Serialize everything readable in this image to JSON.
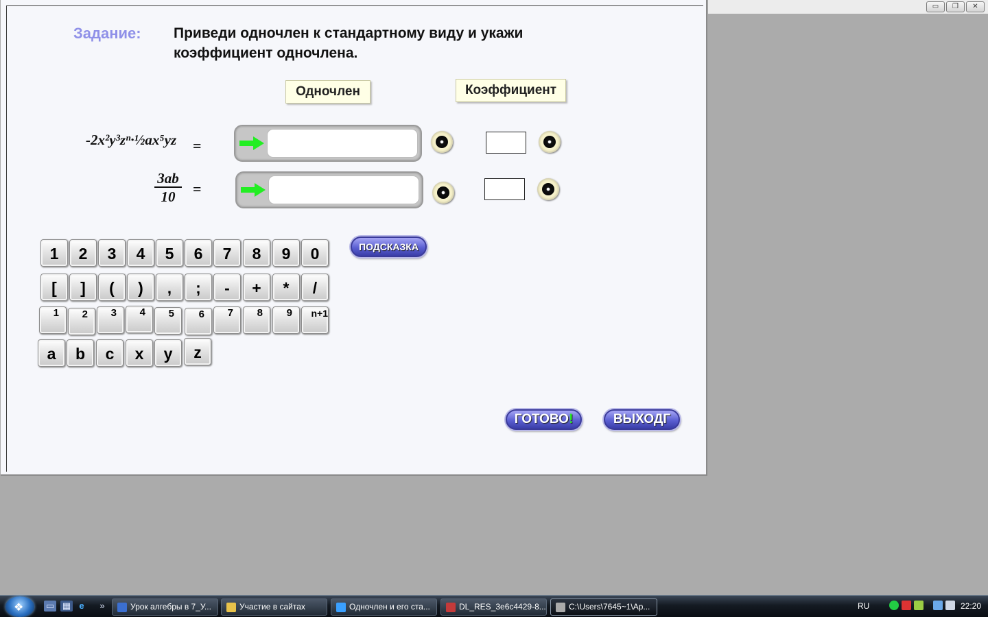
{
  "window": {
    "controls": [
      "minimize",
      "restore",
      "close"
    ],
    "control_glyphs": [
      "▭",
      "❐",
      "✕"
    ]
  },
  "task": {
    "label": "Задание:",
    "text": "Приведи одночлен к стандартному виду и укажи коэффициент одночлена."
  },
  "headers": {
    "monomial": "Одночлен",
    "coefficient": "Коэффициент"
  },
  "rows": [
    {
      "expression": "-2x²y³zⁿ·½ax⁵yz",
      "equals": "="
    },
    {
      "expression_numerator": "3ab",
      "expression_denominator": "10",
      "equals": "="
    }
  ],
  "keyboard": {
    "digits": [
      "1",
      "2",
      "3",
      "4",
      "5",
      "6",
      "7",
      "8",
      "9",
      "0"
    ],
    "symbols": [
      "[",
      "]",
      "(",
      ")",
      ",",
      ";",
      "-",
      "+",
      "*",
      "/"
    ],
    "powers": [
      "1",
      "2",
      "3",
      "4",
      "5",
      "6",
      "7",
      "8",
      "9",
      "n+1"
    ],
    "letters": [
      "a",
      "b",
      "c",
      "x",
      "y",
      "z"
    ]
  },
  "buttons": {
    "hint": "ПОДСКАЗКА",
    "done": "ГОТОВО",
    "done_mark": "!",
    "exit": "ВЫХОД",
    "exit_mark": "Г"
  },
  "taskbar": {
    "items": [
      {
        "label": "Урок алгебры в 7_У...",
        "icon_color": "#3b6fd0",
        "active": false
      },
      {
        "label": "Участие в сайтах",
        "icon_color": "#e8c24a",
        "active": false
      },
      {
        "label": "Одночлен и его ста...",
        "icon_color": "#3aa0ff",
        "active": false
      },
      {
        "label": "DL_RES_3e6c4429-8...",
        "icon_color": "#c43a3a",
        "active": false
      },
      {
        "label": "C:\\Users\\7645~1\\Ap...",
        "icon_color": "#aaaaaa",
        "active": true
      }
    ],
    "quick_launch": [
      "show-desktop-icon",
      "switch-windows-icon",
      "ie-icon"
    ],
    "language": "RU",
    "clock": "22:20"
  }
}
